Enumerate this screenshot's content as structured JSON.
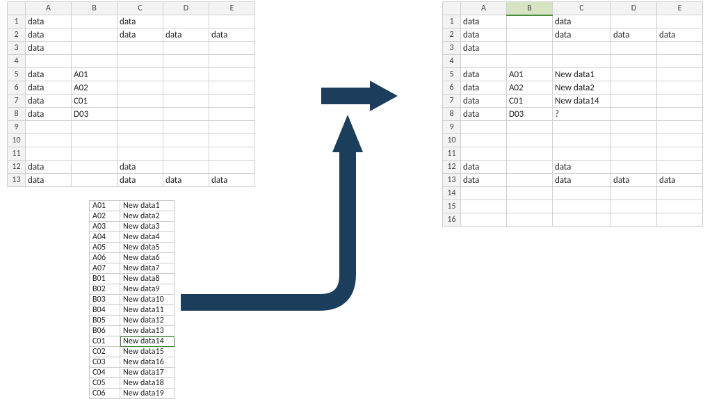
{
  "colHeaders": [
    "A",
    "B",
    "C",
    "D",
    "E"
  ],
  "leftSheet": {
    "rows": [
      {
        "n": "1",
        "A": "data",
        "B": "",
        "C": "data",
        "D": "",
        "E": ""
      },
      {
        "n": "2",
        "A": "data",
        "B": "",
        "C": "data",
        "D": "data",
        "E": "data"
      },
      {
        "n": "3",
        "A": "data",
        "B": "",
        "C": "",
        "D": "",
        "E": ""
      },
      {
        "n": "4",
        "A": "",
        "B": "",
        "C": "",
        "D": "",
        "E": ""
      },
      {
        "n": "5",
        "A": "data",
        "B": "A01",
        "C": "",
        "D": "",
        "E": ""
      },
      {
        "n": "6",
        "A": "data",
        "B": "A02",
        "C": "",
        "D": "",
        "E": ""
      },
      {
        "n": "7",
        "A": "data",
        "B": "C01",
        "C": "",
        "D": "",
        "E": ""
      },
      {
        "n": "8",
        "A": "data",
        "B": "D03",
        "C": "",
        "D": "",
        "E": ""
      },
      {
        "n": "9",
        "A": "",
        "B": "",
        "C": "",
        "D": "",
        "E": ""
      },
      {
        "n": "10",
        "A": "",
        "B": "",
        "C": "",
        "D": "",
        "E": ""
      },
      {
        "n": "11",
        "A": "",
        "B": "",
        "C": "",
        "D": "",
        "E": ""
      },
      {
        "n": "12",
        "A": "data",
        "B": "",
        "C": "data",
        "D": "",
        "E": ""
      },
      {
        "n": "13",
        "A": "data",
        "B": "",
        "C": "data",
        "D": "data",
        "E": "data"
      }
    ]
  },
  "rightSheet": {
    "selectedCol": "B",
    "rows": [
      {
        "n": "1",
        "A": "data",
        "B": "",
        "C": "data",
        "D": "",
        "E": ""
      },
      {
        "n": "2",
        "A": "data",
        "B": "",
        "C": "data",
        "D": "data",
        "E": "data"
      },
      {
        "n": "3",
        "A": "data",
        "B": "",
        "C": "",
        "D": "",
        "E": ""
      },
      {
        "n": "4",
        "A": "",
        "B": "",
        "C": "",
        "D": "",
        "E": ""
      },
      {
        "n": "5",
        "A": "data",
        "B": "A01",
        "C": "New data1",
        "D": "",
        "E": ""
      },
      {
        "n": "6",
        "A": "data",
        "B": "A02",
        "C": "New data2",
        "D": "",
        "E": ""
      },
      {
        "n": "7",
        "A": "data",
        "B": "C01",
        "C": "New data14",
        "D": "",
        "E": ""
      },
      {
        "n": "8",
        "A": "data",
        "B": "D03",
        "C": "?",
        "D": "",
        "E": ""
      },
      {
        "n": "9",
        "A": "",
        "B": "",
        "C": "",
        "D": "",
        "E": ""
      },
      {
        "n": "10",
        "A": "",
        "B": "",
        "C": "",
        "D": "",
        "E": ""
      },
      {
        "n": "11",
        "A": "",
        "B": "",
        "C": "",
        "D": "",
        "E": ""
      },
      {
        "n": "12",
        "A": "data",
        "B": "",
        "C": "data",
        "D": "",
        "E": ""
      },
      {
        "n": "13",
        "A": "data",
        "B": "",
        "C": "data",
        "D": "data",
        "E": "data"
      },
      {
        "n": "14",
        "A": "",
        "B": "",
        "C": "",
        "D": "",
        "E": ""
      },
      {
        "n": "15",
        "A": "",
        "B": "",
        "C": "",
        "D": "",
        "E": ""
      },
      {
        "n": "16",
        "A": "",
        "B": "",
        "C": "",
        "D": "",
        "E": ""
      }
    ]
  },
  "lookup": {
    "selectedRow": 13,
    "rows": [
      {
        "k": "A01",
        "v": "New data1"
      },
      {
        "k": "A02",
        "v": "New data2"
      },
      {
        "k": "A03",
        "v": "New data3"
      },
      {
        "k": "A04",
        "v": "New data4"
      },
      {
        "k": "A05",
        "v": "New data5"
      },
      {
        "k": "A06",
        "v": "New data6"
      },
      {
        "k": "A07",
        "v": "New data7"
      },
      {
        "k": "B01",
        "v": "New data8"
      },
      {
        "k": "B02",
        "v": "New data9"
      },
      {
        "k": "B03",
        "v": "New data10"
      },
      {
        "k": "B04",
        "v": "New data11"
      },
      {
        "k": "B05",
        "v": "New data12"
      },
      {
        "k": "B06",
        "v": "New data13"
      },
      {
        "k": "C01",
        "v": "New data14"
      },
      {
        "k": "C02",
        "v": "New data15"
      },
      {
        "k": "C03",
        "v": "New data16"
      },
      {
        "k": "C04",
        "v": "New data17"
      },
      {
        "k": "C05",
        "v": "New data18"
      },
      {
        "k": "C06",
        "v": "New data19"
      }
    ]
  },
  "arrowColor": "#1b3e5c"
}
